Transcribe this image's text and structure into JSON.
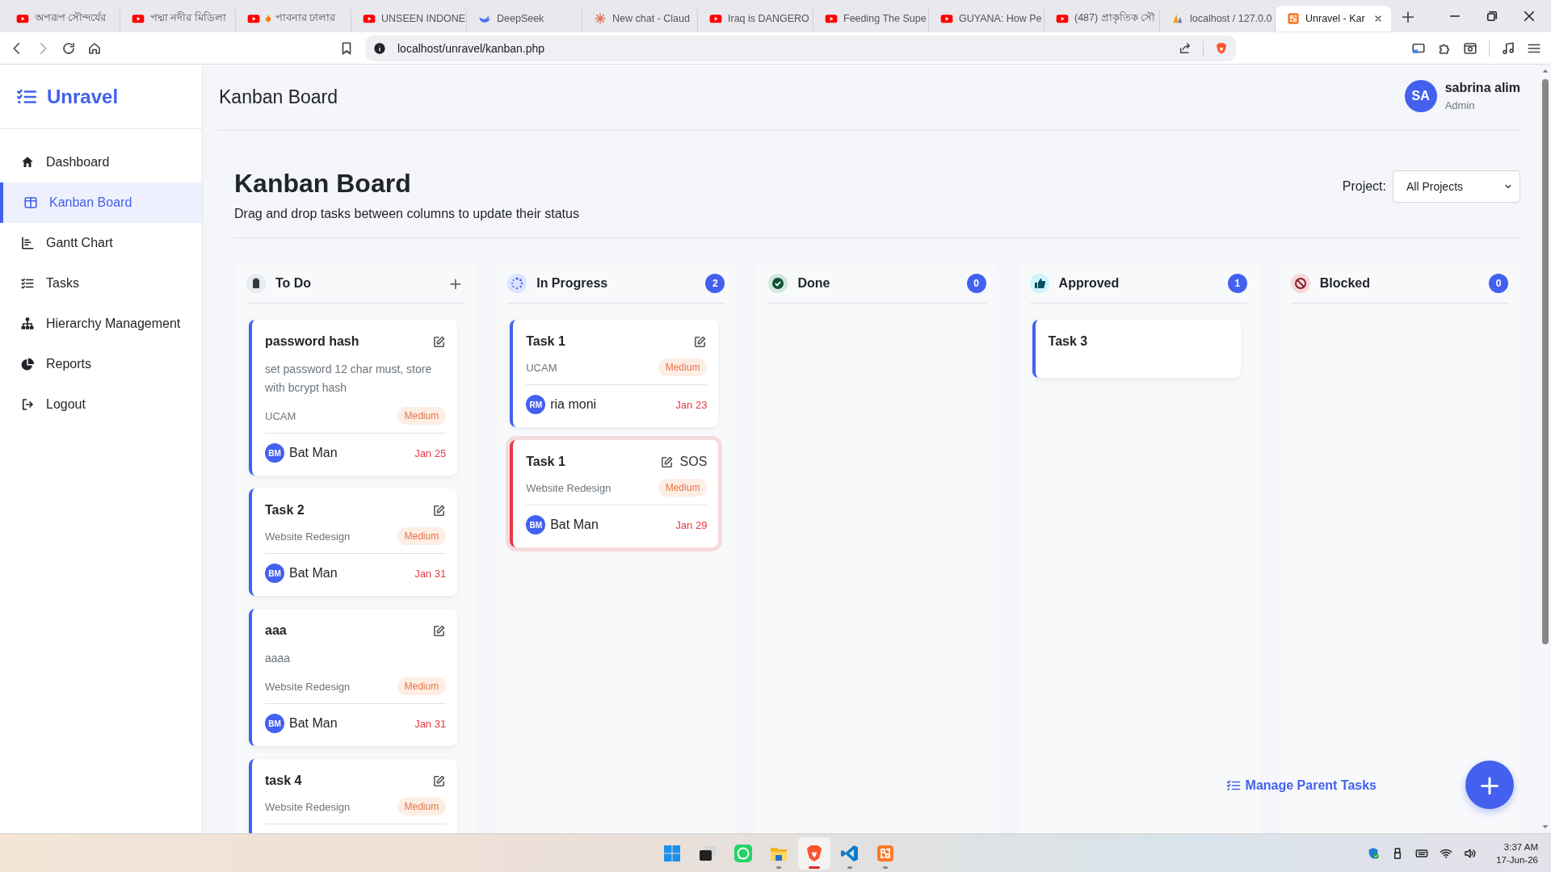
{
  "browser": {
    "tabs": [
      {
        "title": "অপরূপ সৌন্দর্যের",
        "kind": "youtube",
        "selected": false
      },
      {
        "title": "পদ্মা নদীর মিডিলা",
        "kind": "youtube",
        "selected": false
      },
      {
        "title": "পাবনার ঢালার",
        "kind": "youtube_flame",
        "selected": false
      },
      {
        "title": "UNSEEN INDONE",
        "kind": "youtube",
        "selected": false
      },
      {
        "title": "DeepSeek",
        "kind": "deepseek",
        "selected": false
      },
      {
        "title": "New chat - Claud",
        "kind": "claude",
        "selected": false
      },
      {
        "title": "Iraq is DANGERO",
        "kind": "youtube",
        "selected": false
      },
      {
        "title": "Feeding The Supe",
        "kind": "youtube",
        "selected": false
      },
      {
        "title": "GUYANA: How Pe",
        "kind": "youtube",
        "selected": false
      },
      {
        "title": "(487) প্রাকৃতিক সৌ",
        "kind": "youtube",
        "selected": false
      },
      {
        "title": "localhost / 127.0.0",
        "kind": "pma",
        "selected": false
      },
      {
        "title": "Unravel - Kar",
        "kind": "xampp",
        "selected": true
      }
    ],
    "new_tab": "+",
    "url": "localhost/unravel/kanban.php"
  },
  "sidebar": {
    "logo": "Unravel",
    "items": [
      {
        "label": "Dashboard",
        "kind": "home",
        "selected": false
      },
      {
        "label": "Kanban Board",
        "kind": "columns",
        "selected": true
      },
      {
        "label": "Gantt Chart",
        "kind": "gantt",
        "selected": false
      },
      {
        "label": "Tasks",
        "kind": "tasks",
        "selected": false
      },
      {
        "label": "Hierarchy Management",
        "kind": "sitemap",
        "selected": false
      },
      {
        "label": "Reports",
        "kind": "pie",
        "selected": false
      },
      {
        "label": "Logout",
        "kind": "logout",
        "selected": false
      }
    ]
  },
  "header": {
    "title": "Kanban Board",
    "user": {
      "initials": "SA",
      "name": "sabrina alim",
      "role": "Admin"
    }
  },
  "board": {
    "title": "Kanban Board",
    "subtitle": "Drag and drop tasks between columns to update their status",
    "project_filter": {
      "label": "Project:",
      "value": "All Projects"
    }
  },
  "columns": [
    {
      "title": "To Do",
      "kind": "clipboard",
      "add": "+",
      "tasks": [
        {
          "title": "password hash",
          "description": "set password 12 char must, store with bcrypt hash",
          "project": "UCAM",
          "priority": "Medium",
          "assignee": {
            "initials": "BM",
            "name": "Bat Man"
          },
          "due": "Jan 25",
          "urgent": false
        },
        {
          "title": "Task 2",
          "project": "Website Redesign",
          "priority": "Medium",
          "assignee": {
            "initials": "BM",
            "name": "Bat Man"
          },
          "due": "Jan 31",
          "urgent": false
        },
        {
          "title": "aaa",
          "description": "aaaa",
          "project": "Website Redesign",
          "priority": "Medium",
          "assignee": {
            "initials": "BM",
            "name": "Bat Man"
          },
          "due": "Jan 31",
          "urgent": false
        },
        {
          "title": "task 4",
          "project": "Website Redesign",
          "priority": "Medium",
          "urgent": false
        }
      ]
    },
    {
      "title": "In Progress",
      "kind": "spinner",
      "count": "2",
      "tasks": [
        {
          "title": "Task 1",
          "project": "UCAM",
          "priority": "Medium",
          "assignee": {
            "initials": "RM",
            "name": "ria moni"
          },
          "due": "Jan 23",
          "urgent": false
        },
        {
          "title": "Task 1",
          "flag": "SOS",
          "project": "Website Redesign",
          "priority": "Medium",
          "assignee": {
            "initials": "BM",
            "name": "Bat Man"
          },
          "due": "Jan 29",
          "urgent": true
        }
      ]
    },
    {
      "title": "Done",
      "kind": "check",
      "count": "0"
    },
    {
      "title": "Approved",
      "kind": "thumb",
      "count": "1",
      "tasks": [
        {
          "title": "Task 3",
          "editable": false,
          "urgent": false
        }
      ]
    },
    {
      "title": "Blocked",
      "kind": "ban",
      "count": "0"
    }
  ],
  "footer": {
    "manage_link": "Manage Parent Tasks",
    "fab": "+"
  },
  "taskbar": {
    "apps": [
      {
        "kind": "windows",
        "running": false,
        "selected": false
      },
      {
        "kind": "taskview",
        "running": false,
        "selected": false
      },
      {
        "kind": "whatsapp",
        "running": false,
        "selected": false
      },
      {
        "kind": "files",
        "running": true,
        "selected": false
      },
      {
        "kind": "brave",
        "running": true,
        "selected": true
      },
      {
        "kind": "vscode",
        "running": true,
        "selected": false
      },
      {
        "kind": "xampp",
        "running": true,
        "selected": false
      }
    ],
    "time": "3:37 AM",
    "date": "17-Jun-26"
  }
}
